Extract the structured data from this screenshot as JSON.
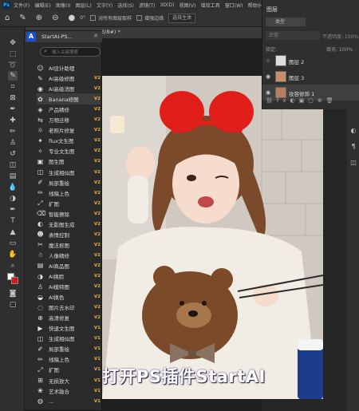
{
  "menubar": {
    "logo": "Ps",
    "items": [
      "文件(F)",
      "编辑(E)",
      "图像(I)",
      "图层(L)",
      "文字(Y)",
      "选择(S)",
      "滤镜(T)",
      "3D(D)",
      "视图(V)",
      "增效工具",
      "窗口(W)",
      "帮助(H)"
    ]
  },
  "optionsbar": {
    "angle": "0°",
    "sample_all_label": "对所有图层取样",
    "enhance_edge_label": "增强边缘",
    "select_subject_label": "选择主体"
  },
  "document": {
    "tab_title": "3/8#) *"
  },
  "plugin": {
    "title": "StartAI-PS...",
    "search_placeholder": "输入关键搜索",
    "items": [
      {
        "label": "AI设计助理",
        "badge": "",
        "icon": "☺"
      },
      {
        "label": "AI高级修图",
        "badge": "V2",
        "icon": "✎"
      },
      {
        "label": "AI高级消图",
        "badge": "V2",
        "icon": "◉"
      },
      {
        "label": "Banana修图",
        "badge": "V2",
        "icon": "✿"
      },
      {
        "label": "产品精修",
        "badge": "V2",
        "icon": "◈"
      },
      {
        "label": "万物迁移",
        "badge": "V2",
        "icon": "⇆"
      },
      {
        "label": "老照片修复",
        "badge": "V2",
        "icon": "☼"
      },
      {
        "label": "flux文生图",
        "badge": "V2",
        "icon": "✦"
      },
      {
        "label": "专业文生图",
        "badge": "V2",
        "icon": "✧"
      },
      {
        "label": "图生图",
        "badge": "V2",
        "icon": "▣"
      },
      {
        "label": "生成相似图",
        "badge": "V2",
        "icon": "◫"
      },
      {
        "label": "局部重绘",
        "badge": "V2",
        "icon": "✐"
      },
      {
        "label": "线稿上色",
        "badge": "V2",
        "icon": "✏"
      },
      {
        "label": "扩图",
        "badge": "V2",
        "icon": "⤢"
      },
      {
        "label": "智能擦除",
        "badge": "V2",
        "icon": "⌫"
      },
      {
        "label": "无影图生成",
        "badge": "V2",
        "icon": "◐"
      },
      {
        "label": "表情控制",
        "badge": "V2",
        "icon": "☻"
      },
      {
        "label": "魔法抠图",
        "badge": "V2",
        "icon": "✂"
      },
      {
        "label": "人像精修",
        "badge": "V2",
        "icon": "☃"
      },
      {
        "label": "AI商品图",
        "badge": "V2",
        "icon": "▤"
      },
      {
        "label": "AI换脸",
        "badge": "V2",
        "icon": "◑"
      },
      {
        "label": "AI模特图",
        "badge": "V2",
        "icon": "♙"
      },
      {
        "label": "AI换色",
        "badge": "V2",
        "icon": "◒"
      },
      {
        "label": "图片去水印",
        "badge": "V2",
        "icon": "◌"
      },
      {
        "label": "高清修复",
        "badge": "V2",
        "icon": "⊕"
      },
      {
        "label": "快速文生图",
        "badge": "V1",
        "icon": "▶"
      },
      {
        "label": "生成相似图",
        "badge": "V1",
        "icon": "◫"
      },
      {
        "label": "局部重绘",
        "badge": "V1",
        "icon": "✐"
      },
      {
        "label": "线稿上色",
        "badge": "V1",
        "icon": "✏"
      },
      {
        "label": "扩图",
        "badge": "V1",
        "icon": "⤢"
      },
      {
        "label": "无损放大",
        "badge": "V1",
        "icon": "⊞"
      },
      {
        "label": "艺术融合",
        "badge": "V1",
        "icon": "❀"
      },
      {
        "label": "...",
        "badge": "V1",
        "icon": "◍"
      }
    ]
  },
  "layers": {
    "title": "图层",
    "kind_label": "类型",
    "blend_mode": "正常",
    "opacity_label": "不透明度: 100%",
    "lock_label": "锁定:",
    "fill_label": "填充: 100%",
    "items": [
      {
        "name": "图层 2",
        "visible": false
      },
      {
        "name": "图层 3",
        "visible": true
      },
      {
        "name": "妆容修饰 1",
        "visible": true
      }
    ]
  },
  "caption": "打开PS插件StartAI",
  "colors": {
    "accent": "#1a4fd6",
    "badge": "#e8b13a",
    "headband": "#e01f1a"
  }
}
